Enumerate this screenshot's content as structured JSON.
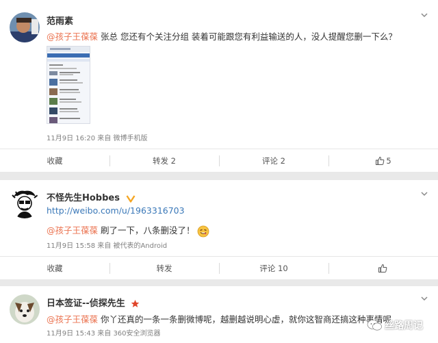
{
  "posts": [
    {
      "author": "范雨素",
      "mention": "@孩子王葆葆",
      "body": " 张总 您还有个关注分组 装着可能跟您有利益输送的人，没人提醒您删一下么？",
      "meta": "11月9日 16:20 来自 微博手机版",
      "actions": {
        "favorite": "收藏",
        "repost": "转发 2",
        "comment": "评论 2",
        "like": "5"
      }
    },
    {
      "author": "不怪先生Hobbes",
      "link": "http://weibo.com/u/1963316703",
      "mention": "@孩子王葆葆",
      "body": " 刷了一下，八条删没了！",
      "meta": "11月9日 15:58 来自 被代表的Android",
      "actions": {
        "favorite": "收藏",
        "repost": "转发",
        "comment": "评论 10",
        "like": ""
      }
    },
    {
      "author": "日本签证--侦探先生",
      "mention": "@孩子王葆葆",
      "body": " 你丫还真的一条一条删微博呢，越删越说明心虚，就你这智商还搞这种事情呢",
      "meta": "11月9日 15:43 来自 360安全浏览器"
    }
  ],
  "watermark": "丝路周记",
  "colors": {
    "mention": "#eb7350",
    "link": "#3a78b8",
    "vip": "#f5a623",
    "star": "#e0452a"
  }
}
